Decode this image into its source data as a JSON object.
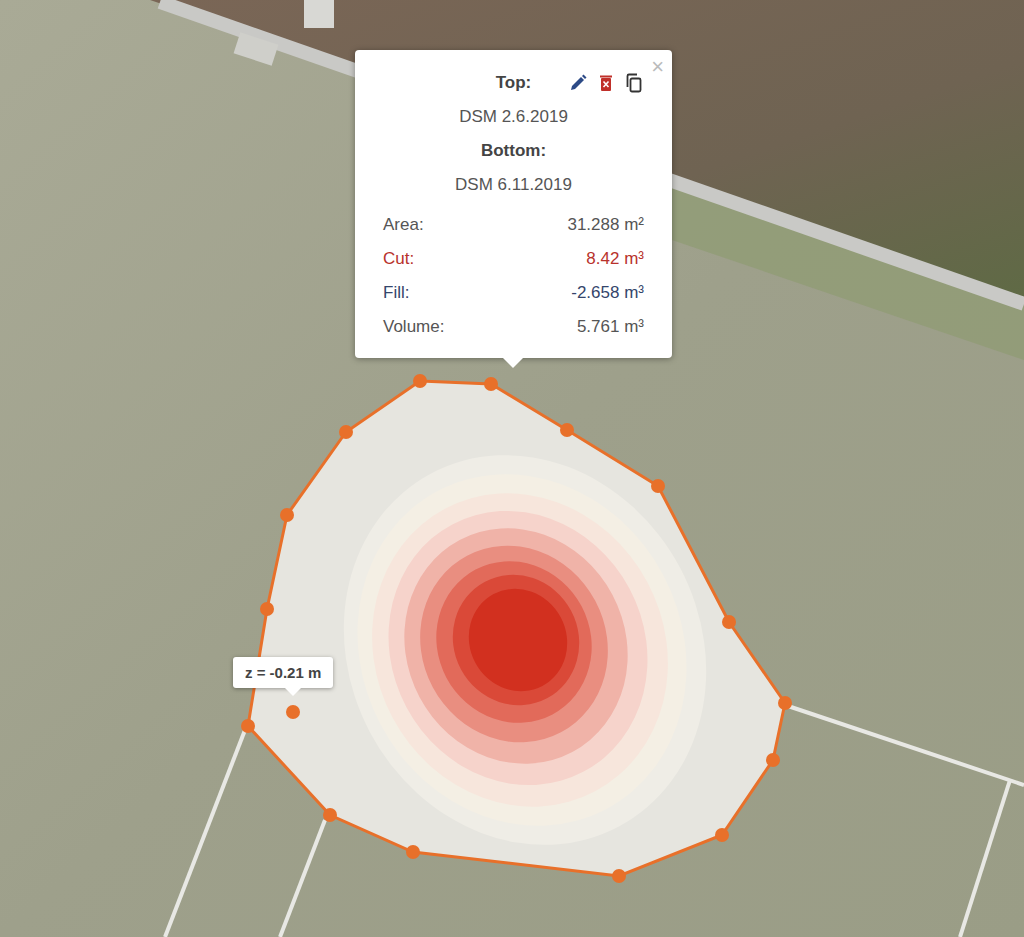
{
  "popup": {
    "close": "×",
    "top": {
      "label": "Top:",
      "value": "DSM 2.6.2019"
    },
    "bottom": {
      "label": "Bottom:",
      "value": "DSM 6.11.2019"
    },
    "rows": [
      {
        "label": "Area:",
        "value": "31.288 m²",
        "color": "#555555"
      },
      {
        "label": "Cut:",
        "value": "8.42 m³",
        "color": "#b8322c"
      },
      {
        "label": "Fill:",
        "value": "-2.658 m³",
        "color": "#34456b"
      },
      {
        "label": "Volume:",
        "value": "5.761 m³",
        "color": "#555555"
      }
    ]
  },
  "tooltip": {
    "text": "z = -0.21 m"
  }
}
